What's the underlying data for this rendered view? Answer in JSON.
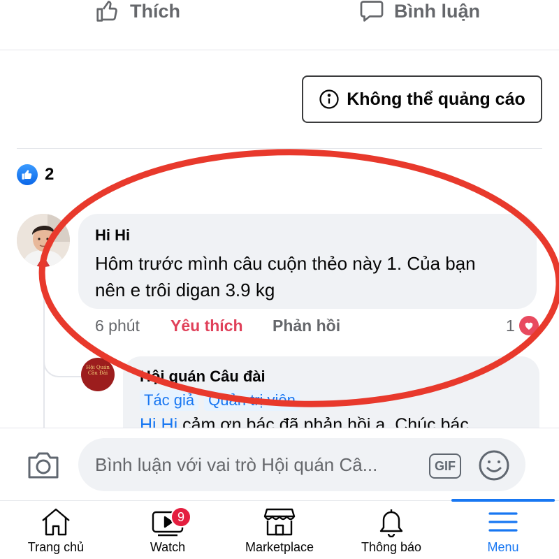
{
  "actions": {
    "like_label": "Thích",
    "comment_label": "Bình luận"
  },
  "ad": {
    "label": "Không thể quảng cáo"
  },
  "reactions": {
    "count": "2"
  },
  "comment": {
    "author": "Hi Hi",
    "text_line1": "Hôm trước mình câu cuộn thẻo này 1. Của bạn",
    "text_line2": "nên e trôi digan 3.9 kg",
    "time": "6 phút",
    "like_label": "Yêu thích",
    "reply_label": "Phản hồi",
    "reaction_count": "1"
  },
  "reply": {
    "author": "Hội quán Câu đài",
    "badge_author": "Tác giả",
    "badge_admin": "Quản trị viên",
    "mention": "Hi Hi",
    "text": " cảm ơn bác đã phản hồi a. Chúc bác",
    "avatar_text": "Hội Quán Câu Đài"
  },
  "composer": {
    "placeholder": "Bình luận với vai trò Hội quán Câ...",
    "gif_label": "GIF"
  },
  "nav": {
    "home": "Trang chủ",
    "watch": "Watch",
    "watch_badge": "9",
    "marketplace": "Marketplace",
    "notifications": "Thông báo",
    "menu": "Menu"
  },
  "colors": {
    "accent": "#1877f2",
    "like_red": "#e0415a",
    "annotation_red": "#e8392c",
    "badge_red": "#e41e3f"
  }
}
